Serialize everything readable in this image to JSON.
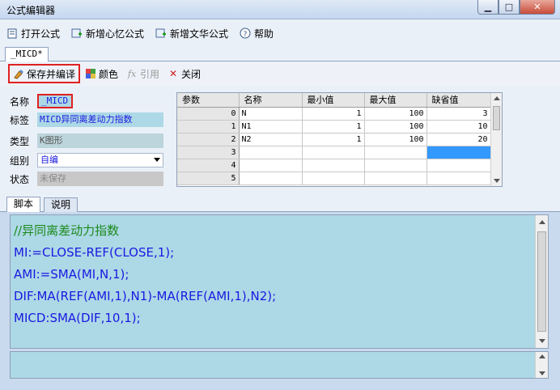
{
  "window": {
    "title": "公式编辑器"
  },
  "menu": {
    "open": "打开公式",
    "new_mind": "新增心忆公式",
    "new_text": "新增文华公式",
    "help": "帮助"
  },
  "doc_tab": "_MICD*",
  "toolbar": {
    "save_compile": "保存并编译",
    "color": "颜色",
    "reference": "引用",
    "close": "关闭"
  },
  "form": {
    "name_label": "名称",
    "name_value": "_MICD",
    "tag_label": "标签",
    "tag_value": "MICD异同离差动力指数",
    "type_label": "类型",
    "type_value": "K图形",
    "group_label": "组别",
    "group_value": "自编",
    "status_label": "状态",
    "status_value": "未保存"
  },
  "params": {
    "headers": [
      "参数",
      "名称",
      "最小值",
      "最大值",
      "缺省值"
    ],
    "rows": [
      {
        "idx": "0",
        "name": "N",
        "min": "1",
        "max": "100",
        "def": "3"
      },
      {
        "idx": "1",
        "name": "N1",
        "min": "1",
        "max": "100",
        "def": "10"
      },
      {
        "idx": "2",
        "name": "N2",
        "min": "1",
        "max": "100",
        "def": "20"
      },
      {
        "idx": "3",
        "name": "",
        "min": "",
        "max": "",
        "def": ""
      },
      {
        "idx": "4",
        "name": "",
        "min": "",
        "max": "",
        "def": ""
      },
      {
        "idx": "5",
        "name": "",
        "min": "",
        "max": "",
        "def": ""
      }
    ]
  },
  "subtabs": {
    "script": "脚本",
    "desc": "说明"
  },
  "script_lines": [
    "//异同离差动力指数",
    "MI:=CLOSE-REF(CLOSE,1);",
    "AMI:=SMA(MI,N,1);",
    "DIF:MA(REF(AMI,1),N1)-MA(REF(AMI,1),N2);",
    "MICD:SMA(DIF,10,1);"
  ],
  "colors": {
    "field_bg": "#add8e6",
    "code_text": "#1a1ae0",
    "comment_text": "#1a8a1a",
    "highlight_border": "#e02020"
  }
}
